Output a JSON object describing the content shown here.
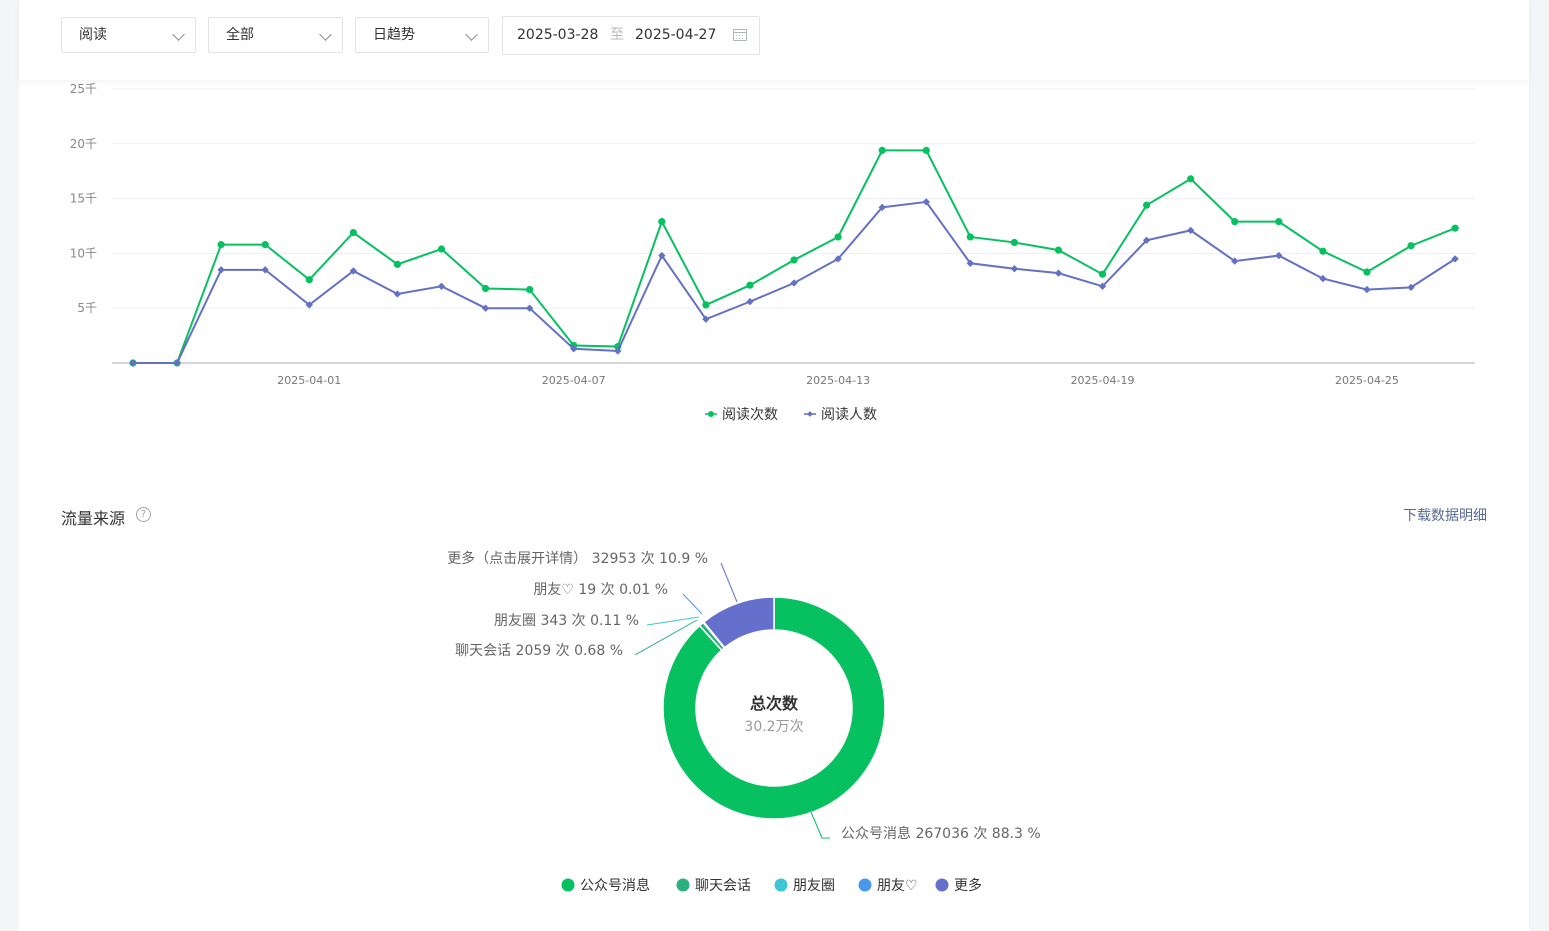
{
  "filters": {
    "metric": "阅读",
    "scope": "全部",
    "period": "日趋势",
    "date_start": "2025-03-28",
    "date_sep": "至",
    "date_end": "2025-04-27"
  },
  "line_chart": {
    "y_ticks": [
      "5千",
      "10千",
      "15千",
      "20千",
      "25千"
    ],
    "x_ticks": [
      "2025-04-01",
      "2025-04-07",
      "2025-04-13",
      "2025-04-19",
      "2025-04-25"
    ]
  },
  "traffic": {
    "title": "流量来源",
    "help": "?",
    "download": "下载数据明细",
    "center_title": "总次数",
    "center_value": "30.2万次"
  },
  "colors": {
    "reads": "#07c160",
    "readers": "#6470c4",
    "gongzhonghao": "#07c160",
    "chat": "#2bb17f",
    "moments": "#3cc6d6",
    "friend": "#4a99e8",
    "more": "#6470cc"
  },
  "chart_data": [
    {
      "type": "line",
      "x": [
        "2025-03-28",
        "2025-03-29",
        "2025-03-30",
        "2025-03-31",
        "2025-04-01",
        "2025-04-02",
        "2025-04-03",
        "2025-04-04",
        "2025-04-05",
        "2025-04-06",
        "2025-04-07",
        "2025-04-08",
        "2025-04-09",
        "2025-04-10",
        "2025-04-11",
        "2025-04-12",
        "2025-04-13",
        "2025-04-14",
        "2025-04-15",
        "2025-04-16",
        "2025-04-17",
        "2025-04-18",
        "2025-04-19",
        "2025-04-20",
        "2025-04-21",
        "2025-04-22",
        "2025-04-23",
        "2025-04-24",
        "2025-04-25",
        "2025-04-26",
        "2025-04-27"
      ],
      "series": [
        {
          "name": "阅读次数",
          "values": [
            0,
            0,
            10800,
            10800,
            7600,
            11900,
            9000,
            10400,
            6800,
            6700,
            1600,
            1500,
            12900,
            5300,
            7100,
            9400,
            11500,
            19400,
            19400,
            11500,
            11000,
            10300,
            8100,
            14400,
            16800,
            12900,
            12900,
            10200,
            8300,
            10700,
            12300
          ]
        },
        {
          "name": "阅读人数",
          "values": [
            0,
            0,
            8500,
            8500,
            5300,
            8400,
            6300,
            7000,
            5000,
            5000,
            1300,
            1100,
            9800,
            4000,
            5600,
            7300,
            9500,
            14200,
            14700,
            9100,
            8600,
            8200,
            7000,
            11200,
            12100,
            9300,
            9800,
            7700,
            6700,
            6900,
            9500
          ]
        }
      ],
      "ylim": [
        0,
        25000
      ],
      "y_ticks": [
        5000,
        10000,
        15000,
        20000,
        25000
      ],
      "legend": "bottom-center",
      "grid": true
    },
    {
      "type": "pie",
      "slices": [
        {
          "name": "公众号消息",
          "value": 267036,
          "percent": 88.3,
          "label": "公众号消息 267036 次 88.3 %"
        },
        {
          "name": "聊天会话",
          "value": 2059,
          "percent": 0.68,
          "label": "聊天会话 2059 次 0.68 %"
        },
        {
          "name": "朋友圈",
          "value": 343,
          "percent": 0.11,
          "label": "朋友圈 343 次 0.11 %"
        },
        {
          "name": "朋友♡",
          "value": 19,
          "percent": 0.01,
          "label": "朋友♡ 19 次 0.01 %"
        },
        {
          "name": "更多",
          "value": 32953,
          "percent": 10.9,
          "label": "更多（点击展开详情） 32953 次 10.9 %"
        }
      ],
      "legend": "bottom-center"
    }
  ]
}
